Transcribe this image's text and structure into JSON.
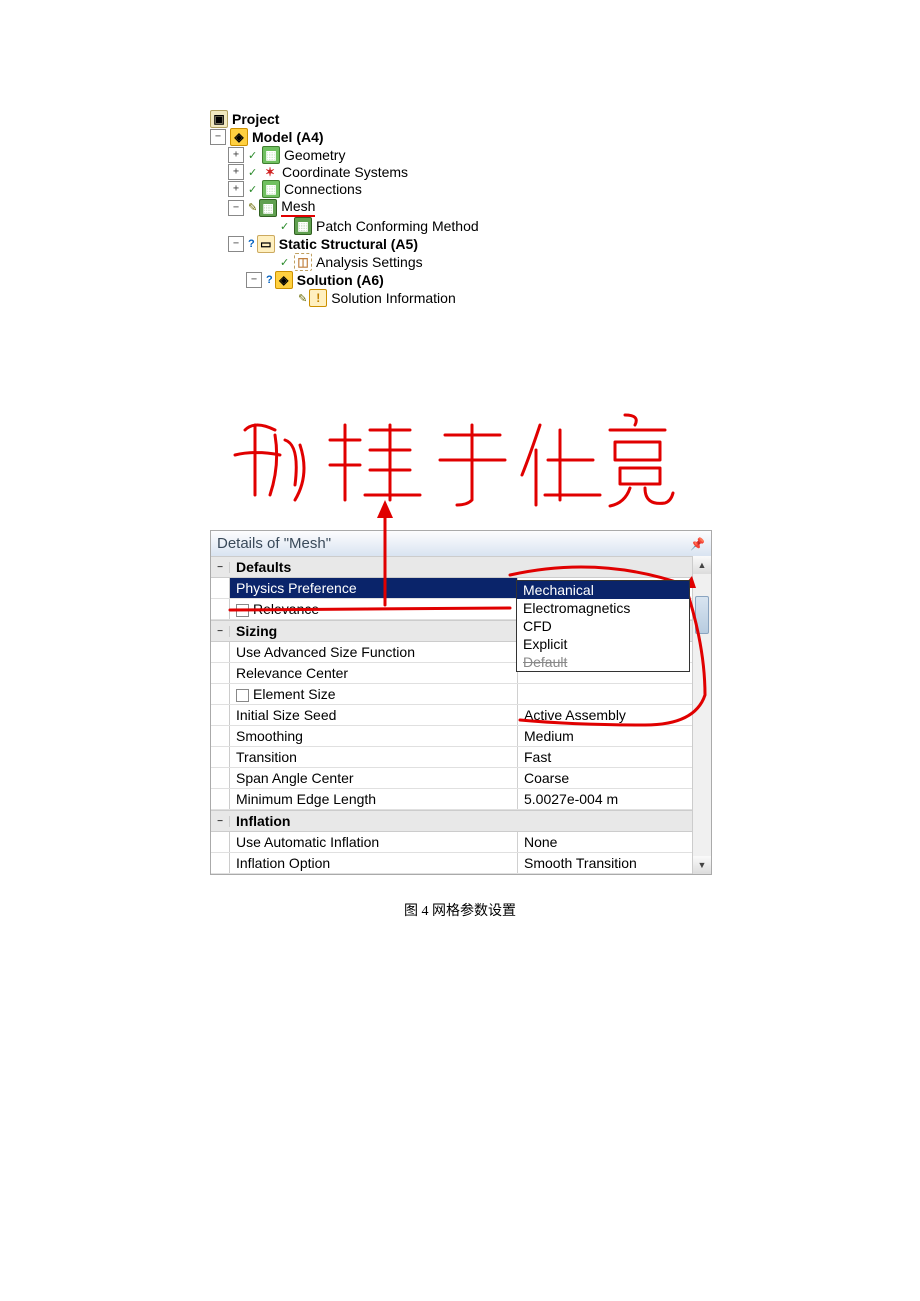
{
  "tree": {
    "project": "Project",
    "model": "Model (A4)",
    "geometry": "Geometry",
    "coord": "Coordinate Systems",
    "connections": "Connections",
    "mesh": "Mesh",
    "patch": "Patch Conforming Method",
    "static": "Static Structural (A5)",
    "analysis": "Analysis Settings",
    "solution": "Solution (A6)",
    "solinfo": "Solution Information"
  },
  "details_title": "Details of \"Mesh\"",
  "groups": {
    "defaults": "Defaults",
    "sizing": "Sizing",
    "inflation": "Inflation"
  },
  "rows": {
    "physics_preference": {
      "name": "Physics Preference",
      "value": "Mechanical"
    },
    "relevance": {
      "name": "Relevance",
      "value": ""
    },
    "use_advanced": {
      "name": "Use Advanced Size Function",
      "value": ""
    },
    "relevance_center": {
      "name": "Relevance Center",
      "value": ""
    },
    "element_size": {
      "name": "Element Size",
      "value": ""
    },
    "initial_size_seed": {
      "name": "Initial Size Seed",
      "value": "Active Assembly"
    },
    "smoothing": {
      "name": "Smoothing",
      "value": "Medium"
    },
    "transition": {
      "name": "Transition",
      "value": "Fast"
    },
    "span_angle_center": {
      "name": "Span Angle Center",
      "value": "Coarse"
    },
    "min_edge_length": {
      "name": "Minimum Edge Length",
      "value": "5.0027e-004 m"
    },
    "auto_inflation": {
      "name": "Use Automatic Inflation",
      "value": "None"
    },
    "inflation_option": {
      "name": "Inflation Option",
      "value": "Smooth Transition"
    }
  },
  "dropdown": {
    "mechanical": "Mechanical",
    "electromagnetics": "Electromagnetics",
    "cfd": "CFD",
    "explicit": "Explicit",
    "default": "Default"
  },
  "caption": "图 4  网格参数设置",
  "expand": {
    "plus": "+",
    "minus": "−"
  }
}
